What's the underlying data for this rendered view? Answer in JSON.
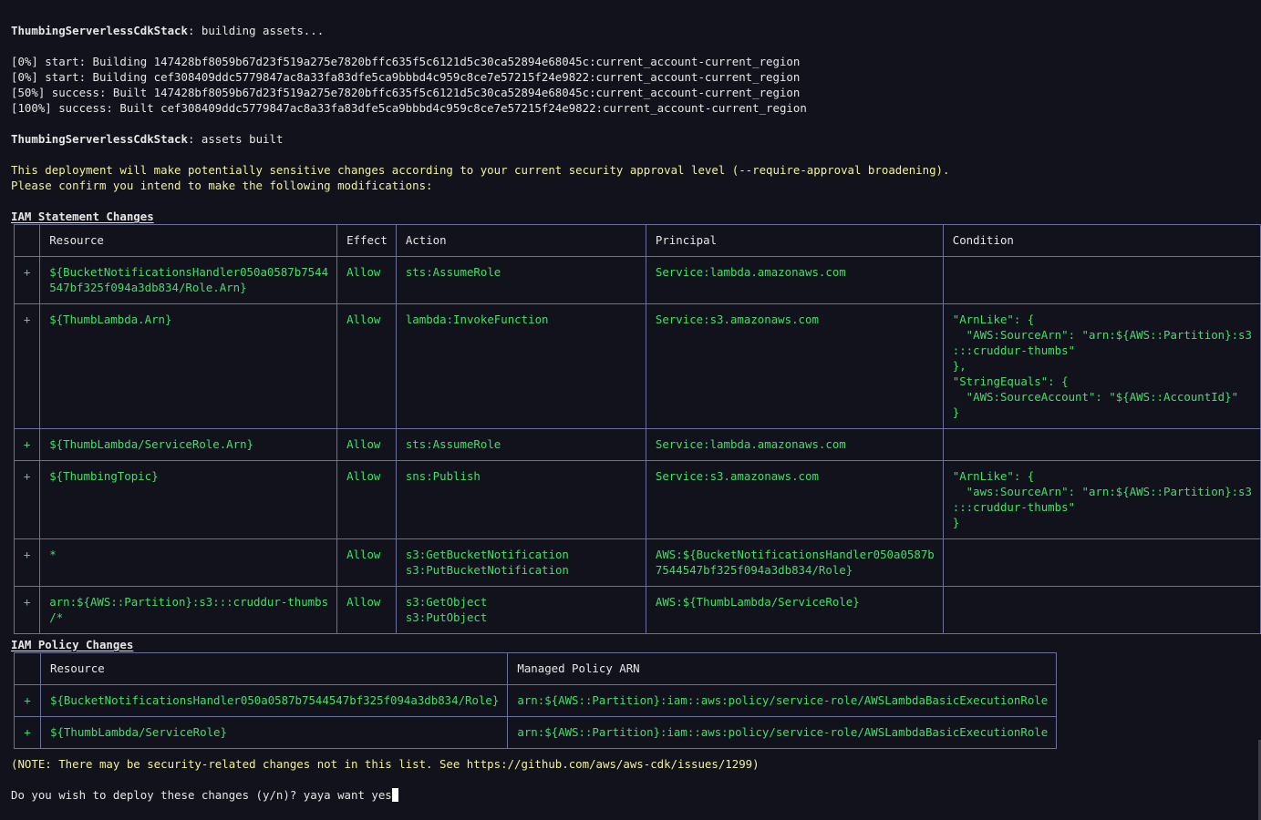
{
  "terminal": {
    "stack_name": "ThumbingServerlessCdkStack",
    "building_suffix": ": building assets...",
    "build_log": [
      "[0%] start: Building 147428bf8059b67d23f519a275e7820bffc635f5c6121d5c30ca52894e68045c:current_account-current_region",
      "[0%] start: Building cef308409ddc5779847ac8a33fa83dfe5ca9bbbd4c959c8ce7e57215f24e9822:current_account-current_region",
      "[50%] success: Built 147428bf8059b67d23f519a275e7820bffc635f5c6121d5c30ca52894e68045c:current_account-current_region",
      "[100%] success: Built cef308409ddc5779847ac8a33fa83dfe5ca9bbbd4c959c8ce7e57215f24e9822:current_account-current_region"
    ],
    "built_suffix": ": assets built",
    "warning_lines": [
      "This deployment will make potentially sensitive changes according to your current security approval level (--require-approval broadening).",
      "Please confirm you intend to make the following modifications:"
    ],
    "statement_section_title": "IAM Statement Changes",
    "statement_table": {
      "headers": [
        "",
        "Resource",
        "Effect",
        "Action",
        "Principal",
        "Condition"
      ],
      "rows": [
        {
          "op": "+",
          "resource": "${BucketNotificationsHandler050a0587b7544\n547bf325f094a3db834/Role.Arn}",
          "effect": "Allow",
          "action": "sts:AssumeRole",
          "principal": "Service:lambda.amazonaws.com",
          "condition": ""
        },
        {
          "op": "+",
          "resource": "${ThumbLambda.Arn}",
          "effect": "Allow",
          "action": "lambda:InvokeFunction",
          "principal": "Service:s3.amazonaws.com",
          "condition": "\"ArnLike\": {\n  \"AWS:SourceArn\": \"arn:${AWS::Partition}:s3\n:::cruddur-thumbs\"\n},\n\"StringEquals\": {\n  \"AWS:SourceAccount\": \"${AWS::AccountId}\"\n}"
        },
        {
          "op": "+",
          "resource": "${ThumbLambda/ServiceRole.Arn}",
          "effect": "Allow",
          "action": "sts:AssumeRole",
          "principal": "Service:lambda.amazonaws.com",
          "condition": ""
        },
        {
          "op": "+",
          "resource": "${ThumbingTopic}",
          "effect": "Allow",
          "action": "sns:Publish",
          "principal": "Service:s3.amazonaws.com",
          "condition": "\"ArnLike\": {\n  \"aws:SourceArn\": \"arn:${AWS::Partition}:s3\n:::cruddur-thumbs\"\n}"
        },
        {
          "op": "+",
          "resource": "*",
          "effect": "Allow",
          "action": "s3:GetBucketNotification\ns3:PutBucketNotification",
          "principal": "AWS:${BucketNotificationsHandler050a0587b\n7544547bf325f094a3db834/Role}",
          "condition": ""
        },
        {
          "op": "+",
          "resource": "arn:${AWS::Partition}:s3:::cruddur-thumbs\n/*",
          "effect": "Allow",
          "action": "s3:GetObject\ns3:PutObject",
          "principal": "AWS:${ThumbLambda/ServiceRole}",
          "condition": ""
        }
      ]
    },
    "policy_section_title": "IAM Policy Changes",
    "policy_table": {
      "headers": [
        "",
        "Resource",
        "Managed Policy ARN"
      ],
      "rows": [
        {
          "op": "+",
          "resource": "${BucketNotificationsHandler050a0587b7544547bf325f094a3db834/Role}",
          "arn": "arn:${AWS::Partition}:iam::aws:policy/service-role/AWSLambdaBasicExecutionRole"
        },
        {
          "op": "+",
          "resource": "${ThumbLambda/ServiceRole}",
          "arn": "arn:${AWS::Partition}:iam::aws:policy/service-role/AWSLambdaBasicExecutionRole"
        }
      ]
    },
    "note": "(NOTE: There may be security-related changes not in this list. See https://github.com/aws/aws-cdk/issues/1299)",
    "prompt": "Do you wish to deploy these changes (y/n)? ",
    "input_value": "yaya want yes"
  },
  "colors": {
    "background": "#12121c",
    "success_green": "#3ee06a",
    "warning_yellow": "#f1f19a",
    "table_border": "#6c6f9c"
  }
}
